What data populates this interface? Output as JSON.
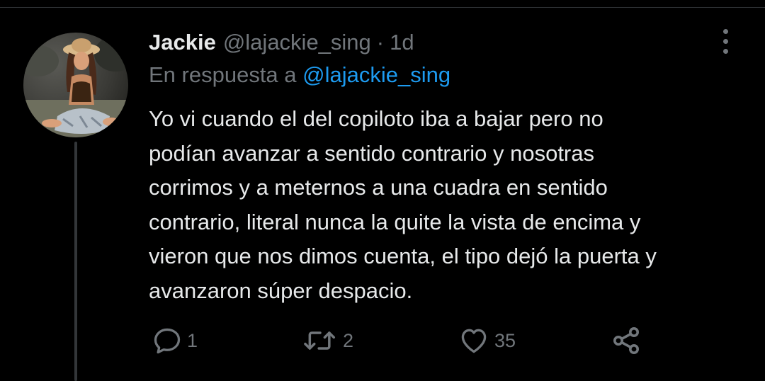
{
  "tweet": {
    "display_name": "Jackie",
    "handle": "@lajackie_sing",
    "separator": "·",
    "time": "1d",
    "reply_prefix": "En respuesta a",
    "reply_mention": "@lajackie_sing",
    "text_lines": [
      "Yo vi cuando el del copiloto iba a bajar pero no",
      "podían avanzar a sentido contrario y nosotras",
      "corrimos y a meternos a una cuadra en sentido",
      "contrario, literal nunca la quite la vista de encima y",
      "vieron que nos dimos cuenta, el tipo dejó la puerta y",
      "avanzaron súper despacio."
    ]
  },
  "actions": {
    "reply": {
      "icon": "reply-icon",
      "count": "1"
    },
    "retweet": {
      "icon": "retweet-icon",
      "count": "2"
    },
    "like": {
      "icon": "heart-icon",
      "count": "35"
    },
    "share": {
      "icon": "share-icon"
    }
  },
  "more_icon": "more-vertical-icon",
  "colors": {
    "background": "#000000",
    "text": "#e7e9ea",
    "muted": "#71767b",
    "accent": "#1d9bf0",
    "thread_line": "#333639"
  }
}
